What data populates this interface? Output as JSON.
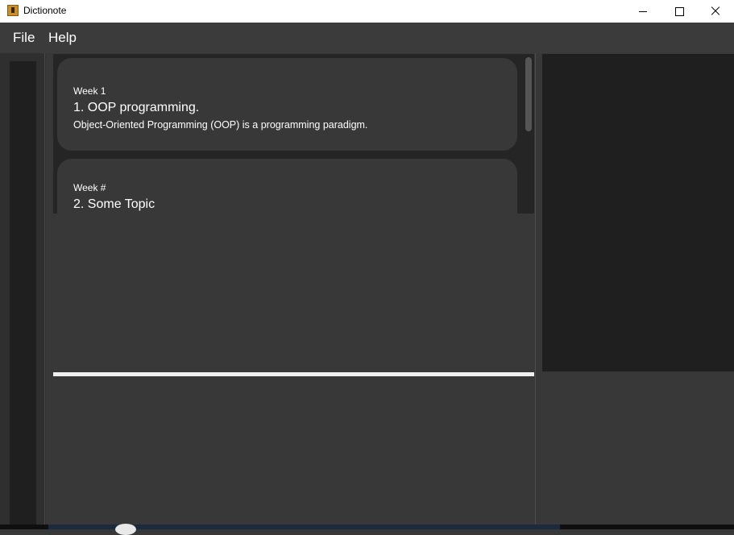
{
  "window": {
    "title": "Dictionote",
    "app_icon": "notebook-icon",
    "controls": [
      "minimize-icon",
      "maximize-icon",
      "close-icon"
    ]
  },
  "menu": {
    "items": [
      {
        "label": "File"
      },
      {
        "label": "Help"
      }
    ]
  },
  "notes": [
    {
      "week": "Week 1",
      "title": "1.  OOP programming.",
      "description": "Object-Oriented Programming (OOP) is a programming paradigm."
    },
    {
      "week": "Week #",
      "title": "2.  Some Topic"
    }
  ],
  "colors": {
    "background": "#383838",
    "card": "#383838",
    "list_background": "#252525",
    "panel_dark": "#1f1f1f",
    "text": "#ffffff"
  }
}
